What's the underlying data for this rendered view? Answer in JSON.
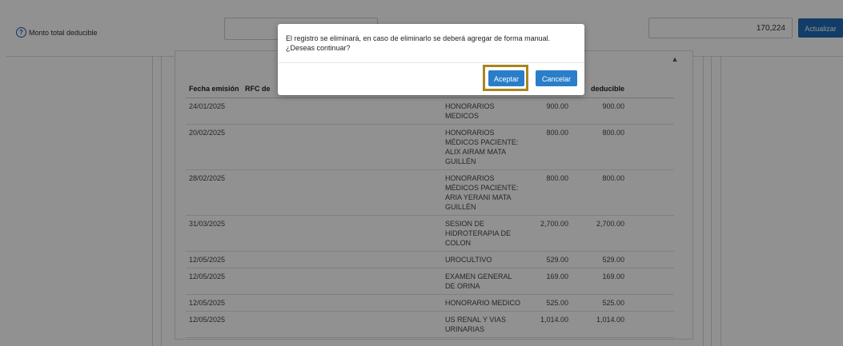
{
  "header": {
    "help_icon_glyph": "?",
    "monto_label": "Monto total deducible",
    "total_value": "170,224",
    "actualizar_label": "Actualizar"
  },
  "table": {
    "columns": [
      "Fecha emisión",
      "RFC de",
      "",
      "",
      "deducible"
    ],
    "rows": [
      {
        "fecha": "24/01/2025",
        "concepto": "HONORARIOS MEDICOS",
        "monto": "900.00",
        "deducible": "900.00"
      },
      {
        "fecha": "20/02/2025",
        "concepto": "HONORARIOS MÉDICOS PACIENTE: ALIX AIRAM MATA GUILLÉN",
        "monto": "800.00",
        "deducible": "800.00"
      },
      {
        "fecha": "28/02/2025",
        "concepto": "HONORARIOS MÉDICOS PACIENTE: ARIA YERANI MATA GUILLÉN",
        "monto": "800.00",
        "deducible": "800.00"
      },
      {
        "fecha": "31/03/2025",
        "concepto": "SESION DE HIDROTERAPIA DE COLON",
        "monto": "2,700.00",
        "deducible": "2,700.00"
      },
      {
        "fecha": "12/05/2025",
        "concepto": "UROCULTIVO",
        "monto": "529.00",
        "deducible": "529.00"
      },
      {
        "fecha": "12/05/2025",
        "concepto": "EXAMEN GENERAL DE ORINA",
        "monto": "169.00",
        "deducible": "169.00"
      },
      {
        "fecha": "12/05/2025",
        "concepto": "HONORARIO MEDICO",
        "monto": "525.00",
        "deducible": "525.00"
      },
      {
        "fecha": "12/05/2025",
        "concepto": "US RENAL Y VIAS URINARIAS",
        "monto": "1,014.00",
        "deducible": "1,014.00"
      }
    ]
  },
  "modal": {
    "message_line1": "El registro se eliminará, en caso de eliminarlo se deberá agregar de forma manual.",
    "message_line2": "¿Deseas continuar?",
    "aceptar_label": "Aceptar",
    "cancelar_label": "Cancelar"
  },
  "colors": {
    "primary": "#2a7ec9",
    "highlight": "#a8861c",
    "overlay": "rgba(0,0,0,0.43)"
  }
}
